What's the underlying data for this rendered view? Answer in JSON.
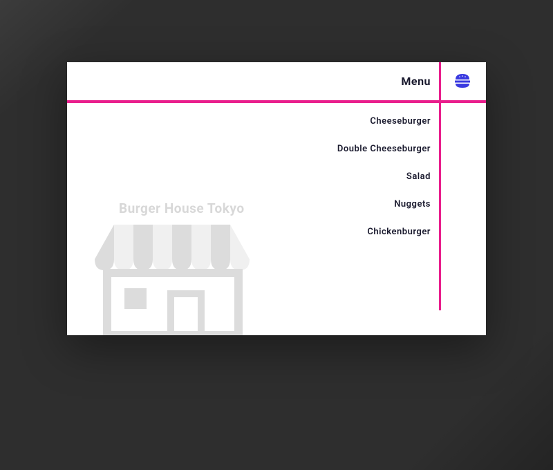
{
  "header": {
    "title": "Menu"
  },
  "brand": {
    "name": "Burger House Tokyo"
  },
  "menu": {
    "items": [
      "Cheeseburger",
      "Double Cheeseburger",
      "Salad",
      "Nuggets",
      "Chickenburger"
    ]
  },
  "colors": {
    "accent": "#e91e8c",
    "icon": "#3a3ae0"
  }
}
